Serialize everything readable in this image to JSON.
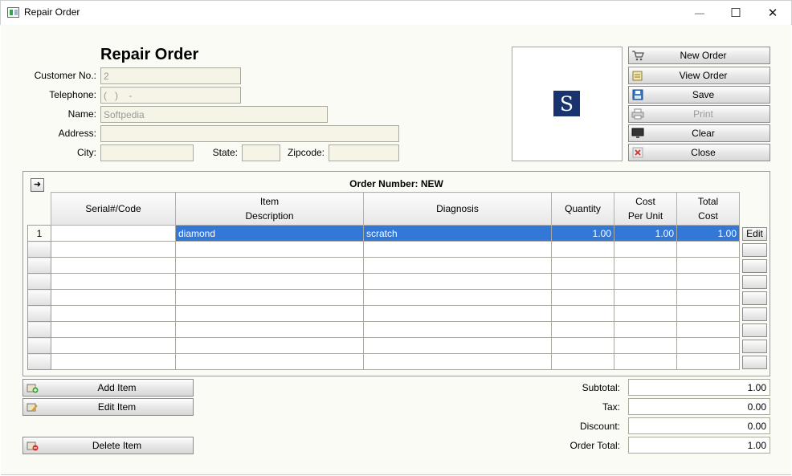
{
  "window": {
    "title": "Repair Order",
    "minimize": "—",
    "maximize": "☐",
    "close": "✕"
  },
  "form": {
    "title": "Repair Order",
    "customer_no": {
      "label": "Customer No.:",
      "value": "2"
    },
    "telephone": {
      "label": "Telephone:",
      "value": "(   )    -"
    },
    "name": {
      "label": "Name:",
      "value": "Softpedia"
    },
    "address": {
      "label": "Address:",
      "value": ""
    },
    "city": {
      "label": "City:",
      "value": ""
    },
    "state": {
      "label": "State:",
      "value": ""
    },
    "zipcode": {
      "label": "Zipcode:",
      "value": ""
    }
  },
  "logo": {
    "letter": "S"
  },
  "buttons": {
    "new_order": "New Order",
    "view_order": "View Order",
    "save": "Save",
    "print": "Print",
    "clear": "Clear",
    "close": "Close",
    "add_item": "Add Item",
    "edit_item": "Edit Item",
    "delete_item": "Delete Item"
  },
  "order": {
    "number_label": "Order Number: NEW",
    "arrow": "➜",
    "columns": [
      "Serial#/Code",
      "Item\nDescription",
      "Diagnosis",
      "Quantity",
      "Cost\nPer Unit",
      "Total\nCost"
    ],
    "rows": [
      {
        "num": "1",
        "serial": "",
        "description": "diamond",
        "diagnosis": "scratch",
        "quantity": "1.00",
        "cost_per_unit": "1.00",
        "total_cost": "1.00",
        "edit": "Edit"
      }
    ],
    "empty_rows": 8
  },
  "totals": {
    "subtotal": {
      "label": "Subtotal:",
      "value": "1.00"
    },
    "tax": {
      "label": "Tax:",
      "value": "0.00"
    },
    "discount": {
      "label": "Discount:",
      "value": "0.00"
    },
    "order_total": {
      "label": "Order Total:",
      "value": "1.00"
    }
  },
  "colors": {
    "selection": "#3377d7",
    "logo_bg": "#18336d",
    "field_bg": "#f5f4e6",
    "client_bg": "#fbfbf5"
  }
}
